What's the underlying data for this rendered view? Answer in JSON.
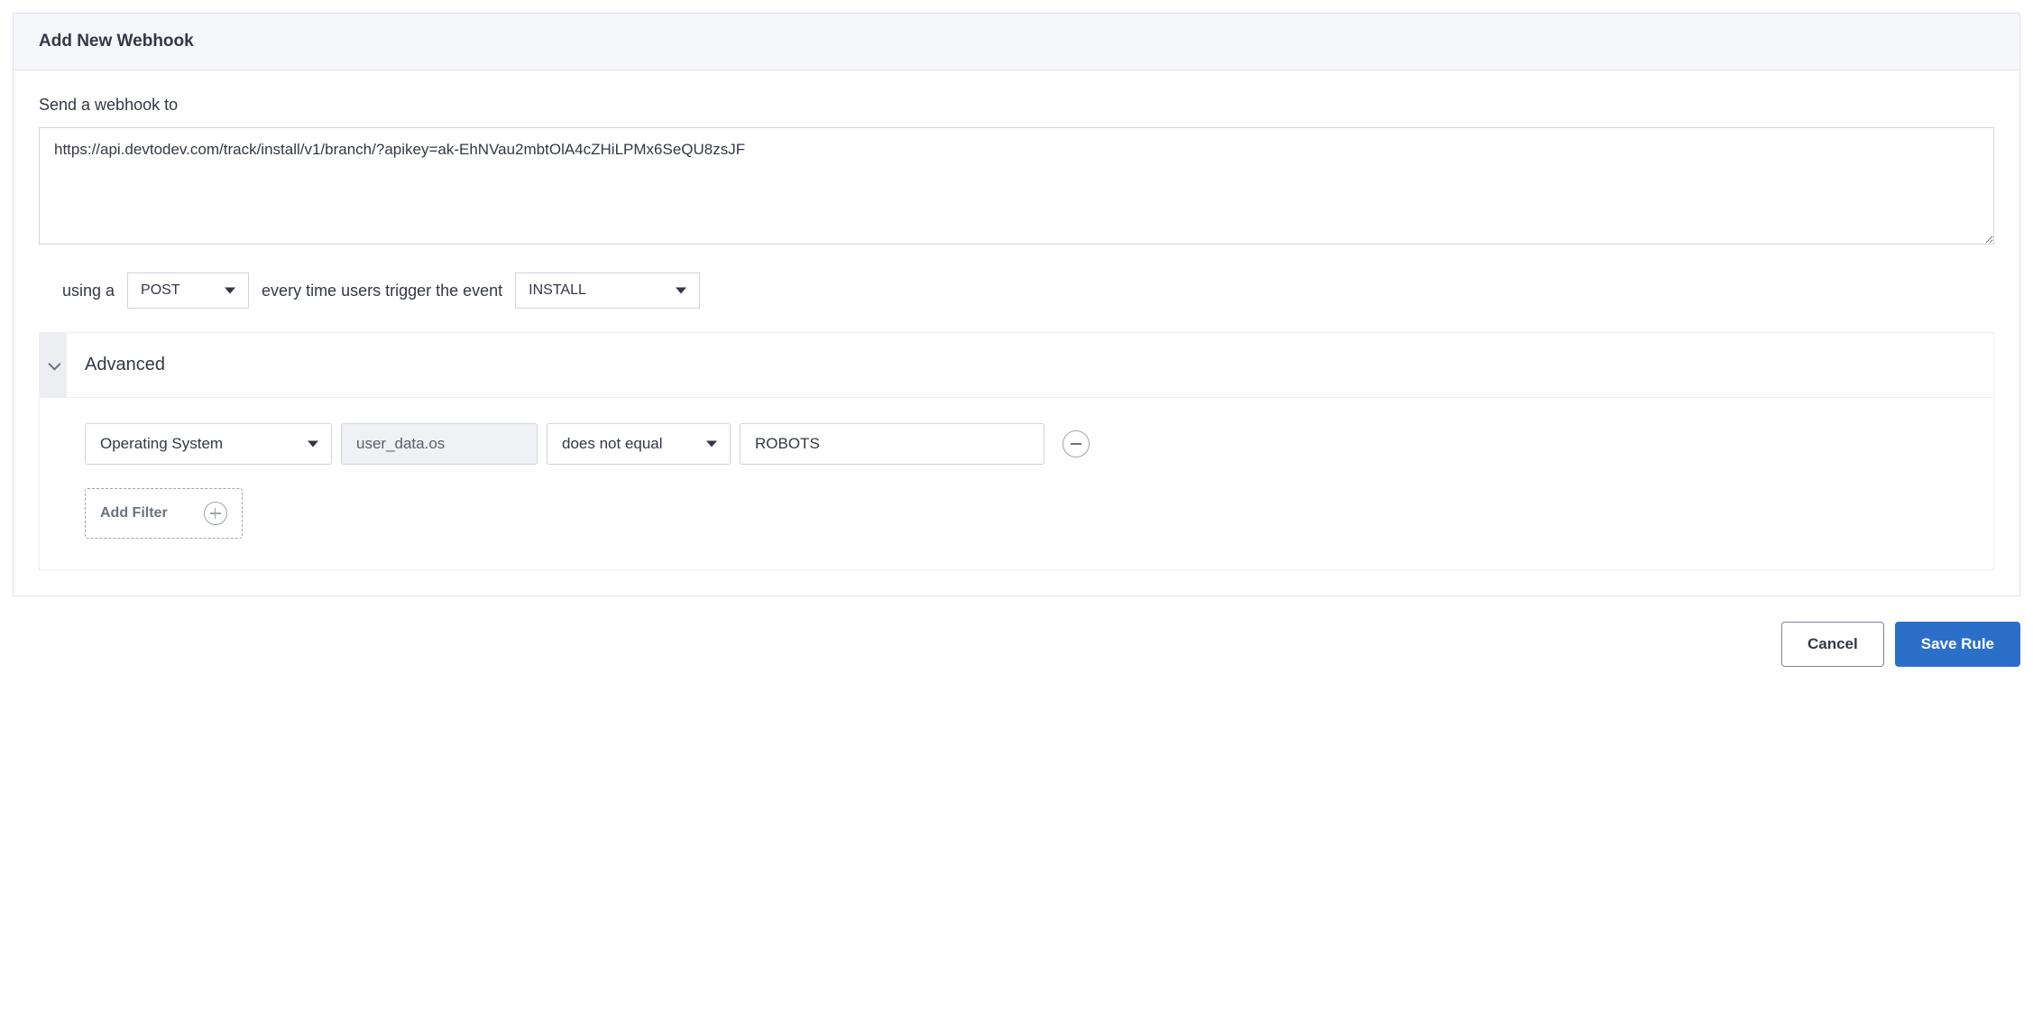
{
  "header": {
    "title": "Add New Webhook"
  },
  "webhook": {
    "label": "Send a webhook to",
    "url_value": "https://api.devtodev.com/track/install/v1/branch/?apikey=ak-EhNVau2mbtOlA4cZHiLPMx6SeQU8zsJF"
  },
  "config": {
    "using_label": "using a",
    "method": "POST",
    "trigger_label": "every time users trigger the event",
    "event": "INSTALL"
  },
  "advanced": {
    "title": "Advanced",
    "filter": {
      "property": "Operating System",
      "field": "user_data.os",
      "operator": "does not equal",
      "value": "ROBOTS"
    },
    "add_filter_label": "Add Filter"
  },
  "buttons": {
    "cancel": "Cancel",
    "save": "Save Rule"
  }
}
